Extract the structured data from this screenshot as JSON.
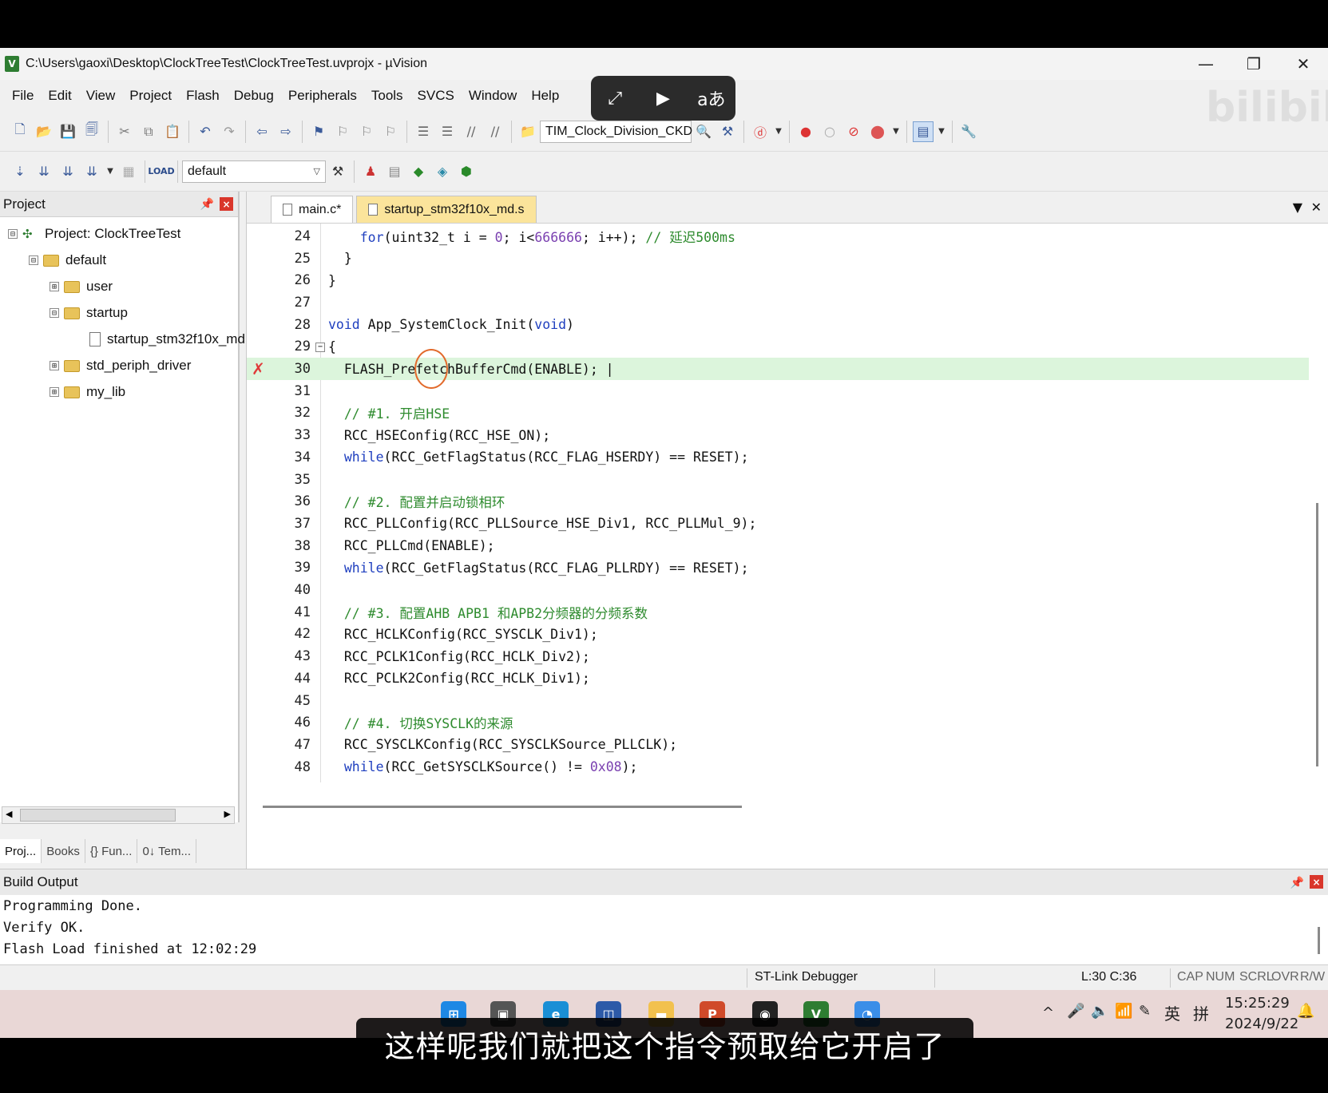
{
  "window": {
    "title": "C:\\Users\\gaoxi\\Desktop\\ClockTreeTest\\ClockTreeTest.uvprojx - µVision",
    "app_icon": "V",
    "controls": {
      "minimize": "—",
      "restore": "❐",
      "close": "✕"
    }
  },
  "menu": [
    "File",
    "Edit",
    "View",
    "Project",
    "Flash",
    "Debug",
    "Peripherals",
    "Tools",
    "SVCS",
    "Window",
    "Help"
  ],
  "overlay": {
    "btn1": "⤢",
    "btn2": "▶",
    "btn3": "aあ"
  },
  "toolbar1": {
    "target_combo": "TIM_Clock_Division_CKD"
  },
  "toolbar2": {
    "target_select": "default"
  },
  "project_panel": {
    "title": "Project",
    "tree": [
      {
        "label": "Project: ClockTreeTest",
        "expander": "⊟",
        "kind": "project"
      },
      {
        "label": "default",
        "expander": "⊟",
        "kind": "folder"
      },
      {
        "label": "user",
        "expander": "⊞",
        "kind": "folder"
      },
      {
        "label": "startup",
        "expander": "⊟",
        "kind": "folder"
      },
      {
        "label": "startup_stm32f10x_md.",
        "expander": "",
        "kind": "file"
      },
      {
        "label": "std_periph_driver",
        "expander": "⊞",
        "kind": "folder"
      },
      {
        "label": "my_lib",
        "expander": "⊞",
        "kind": "folder"
      }
    ],
    "tabs": [
      "Proj...",
      "Books",
      "{} Fun...",
      "0↓ Tem..."
    ]
  },
  "editor": {
    "tabs": [
      "main.c*",
      "startup_stm32f10x_md.s"
    ],
    "lines": [
      {
        "n": "24",
        "code": "    for(uint32_t i = 0; i<666666; i++); // 延迟500ms"
      },
      {
        "n": "25",
        "code": "  }"
      },
      {
        "n": "26",
        "code": "}"
      },
      {
        "n": "27",
        "code": ""
      },
      {
        "n": "28",
        "code": "void App_SystemClock_Init(void)"
      },
      {
        "n": "29",
        "code": "{"
      },
      {
        "n": "30",
        "code": "  FLASH_PrefetchBufferCmd(ENABLE); |"
      },
      {
        "n": "31",
        "code": ""
      },
      {
        "n": "32",
        "code": "  // #1. 开启HSE"
      },
      {
        "n": "33",
        "code": "  RCC_HSEConfig(RCC_HSE_ON);"
      },
      {
        "n": "34",
        "code": "  while(RCC_GetFlagStatus(RCC_FLAG_HSERDY) == RESET);"
      },
      {
        "n": "35",
        "code": ""
      },
      {
        "n": "36",
        "code": "  // #2. 配置并启动锁相环"
      },
      {
        "n": "37",
        "code": "  RCC_PLLConfig(RCC_PLLSource_HSE_Div1, RCC_PLLMul_9);"
      },
      {
        "n": "38",
        "code": "  RCC_PLLCmd(ENABLE);"
      },
      {
        "n": "39",
        "code": "  while(RCC_GetFlagStatus(RCC_FLAG_PLLRDY) == RESET);"
      },
      {
        "n": "40",
        "code": ""
      },
      {
        "n": "41",
        "code": "  // #3. 配置AHB APB1 和APB2分频器的分频系数"
      },
      {
        "n": "42",
        "code": "  RCC_HCLKConfig(RCC_SYSCLK_Div1);"
      },
      {
        "n": "43",
        "code": "  RCC_PCLK1Config(RCC_HCLK_Div2);"
      },
      {
        "n": "44",
        "code": "  RCC_PCLK2Config(RCC_HCLK_Div1);"
      },
      {
        "n": "45",
        "code": ""
      },
      {
        "n": "46",
        "code": "  // #4. 切换SYSCLK的来源"
      },
      {
        "n": "47",
        "code": "  RCC_SYSCLKConfig(RCC_SYSCLKSource_PLLCLK);"
      },
      {
        "n": "48",
        "code": "  while(RCC_GetSYSCLKSource() != 0x08);"
      }
    ],
    "breakpoint_marker": "✗",
    "fold_marker": "−"
  },
  "build_output": {
    "title": "Build Output",
    "lines": [
      "Programming Done.",
      "Verify OK.",
      "Flash Load finished at 12:02:29"
    ]
  },
  "status": {
    "debugger": "ST-Link Debugger",
    "position": "L:30 C:36",
    "indicators": [
      "CAP",
      "NUM",
      "SCRL",
      "OVR",
      "R/W"
    ]
  },
  "taskbar": {
    "time": "15:25:29",
    "date": "2024/9/22",
    "tray": {
      "ime_lang": "英",
      "ime_mode": "拼"
    }
  },
  "subtitle": "这样呢我们就把这个指令预取给它开启了",
  "watermark": "bilibili"
}
